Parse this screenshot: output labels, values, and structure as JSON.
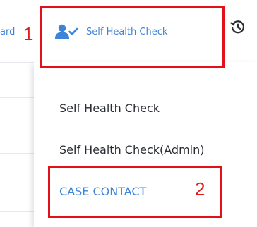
{
  "topnav": {
    "prev_item_partial": "ard",
    "active_item": {
      "label": "Self Health Check",
      "icon": "user-check-icon"
    },
    "next_icon": "history-icon",
    "accent_color": "#3d84d9"
  },
  "dropdown_menu": {
    "items": [
      {
        "label": "Self Health Check"
      },
      {
        "label": "Self Health Check(Admin)"
      },
      {
        "label": "CASE CONTACT",
        "highlighted": true
      }
    ]
  },
  "annotations": {
    "marker_1": "1",
    "marker_2": "2",
    "color": "#e3101a"
  }
}
